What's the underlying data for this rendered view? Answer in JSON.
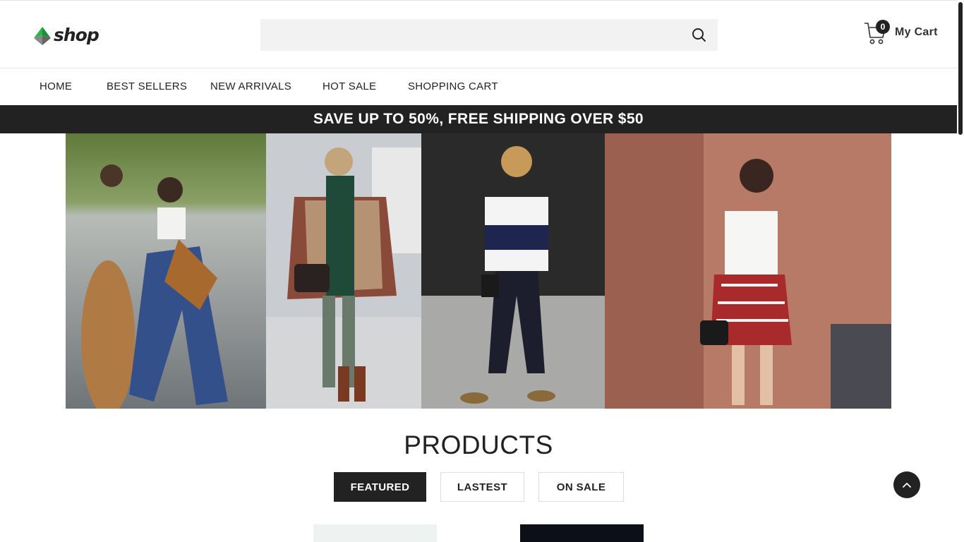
{
  "header": {
    "logo_text": "shop",
    "search": {
      "placeholder": "",
      "value": ""
    },
    "cart": {
      "count": "0",
      "label": "My Cart"
    }
  },
  "nav": {
    "items": [
      {
        "label": "HOME"
      },
      {
        "label": "BEST SELLERS"
      },
      {
        "label": "NEW ARRIVALS"
      },
      {
        "label": "HOT SALE"
      },
      {
        "label": "SHOPPING CART"
      }
    ]
  },
  "promo": {
    "text": "SAVE UP TO 50%, FREE SHIPPING OVER $50"
  },
  "products": {
    "title": "PRODUCTS",
    "tabs": [
      {
        "label": "FEATURED",
        "active": true
      },
      {
        "label": "LASTEST",
        "active": false
      },
      {
        "label": "ON SALE",
        "active": false
      }
    ]
  },
  "colors": {
    "brand_green": "#2db34a",
    "dark": "#222222"
  }
}
